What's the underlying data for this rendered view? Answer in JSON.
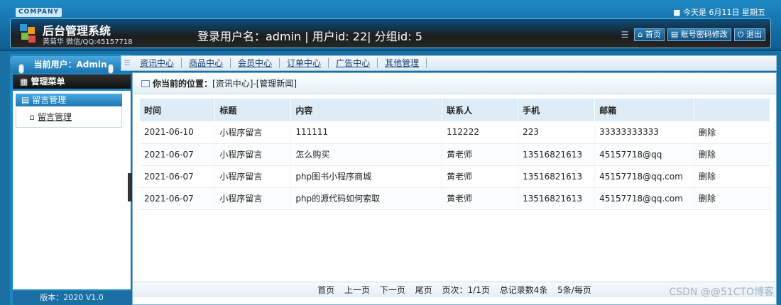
{
  "header": {
    "company": "COMPANY",
    "today": "■ 今天是 6月11日 星期五",
    "system_title": "后台管理系统",
    "system_subtitle": "黄菊华 微信/QQ:45157718",
    "login_info": "登录用户名：admin | 用户id: 22| 分组id: 5",
    "actions": [
      {
        "label": "⌂ 首页",
        "icon": "home-icon"
      },
      {
        "label": "▤ 账号密码修改",
        "icon": "key-icon"
      },
      {
        "label": "⏻ 退出",
        "icon": "power-icon"
      }
    ]
  },
  "sidebar": {
    "current_user": "当前用户：Admin",
    "menu_title": "管理菜单",
    "group_label": "留言管理",
    "link_label": "留言管理",
    "version": "版本：2020 V1.0"
  },
  "nav": {
    "tabs": [
      "资讯中心",
      "商品中心",
      "会员中心",
      "订单中心",
      "广告中心",
      "其他管理"
    ]
  },
  "main": {
    "location_label": "你当前的位置：",
    "location_path": "[资讯中心]-[管理新闻]",
    "columns": [
      "时间",
      "标题",
      "内容",
      "联系人",
      "手机",
      "邮箱",
      ""
    ],
    "rows": [
      [
        "2021-06-10",
        "小程序留言",
        "111111",
        "112222",
        "223",
        "33333333333",
        "删除"
      ],
      [
        "2021-06-07",
        "小程序留言",
        "怎么购买",
        "黄老师",
        "13516821613",
        "45157718@qq",
        "删除"
      ],
      [
        "2021-06-07",
        "小程序留言",
        "php图书小程序商城",
        "黄老师",
        "13516821613",
        "45157718@qq.com",
        "删除"
      ],
      [
        "2021-06-07",
        "小程序留言",
        "php的源代码如何索取",
        "黄老师",
        "13516821613",
        "45157718@qq.com",
        "删除"
      ]
    ],
    "pager": {
      "first": "首页",
      "prev": "上一页",
      "next": "下一页",
      "last": "尾页",
      "page_info": "页次：1/1页",
      "total_info": "总记录数4条",
      "per_page": "5条/每页"
    }
  },
  "watermark": "CSDN @@51CTO博客"
}
